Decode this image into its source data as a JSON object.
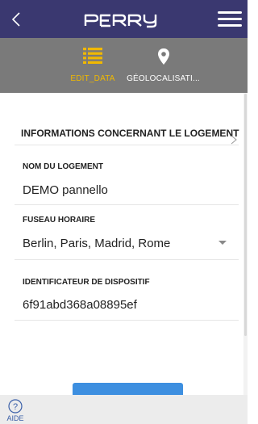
{
  "header": {
    "logo_text": "PERRY",
    "back_icon": "chevron-left-icon",
    "menu_icon": "hamburger-menu-icon",
    "background_color": "#3a3870"
  },
  "tabs": [
    {
      "label": "EDIT_DATA",
      "icon": "list-icon",
      "active": true,
      "color": "#f0b800"
    },
    {
      "label": "GÉOLOCALISATI...",
      "icon": "location-pin-icon",
      "active": false,
      "color": "#ffffff"
    }
  ],
  "section": {
    "title": "INFORMATIONS CONCERNANT LE LOGEMENT"
  },
  "fields": {
    "name_label": "NOM DU LOGEMENT",
    "name_value": "DEMO pannello",
    "timezone_label": "FUSEAU HORAIRE",
    "timezone_value": "Berlin, Paris, Madrid, Rome",
    "device_id_label": "IDENTIFICATEUR DE DISPOSITIF",
    "device_id_value": "6f91abd368a08895ef"
  },
  "footer": {
    "help_label": "AIDE",
    "help_icon": "question-circle-icon"
  }
}
